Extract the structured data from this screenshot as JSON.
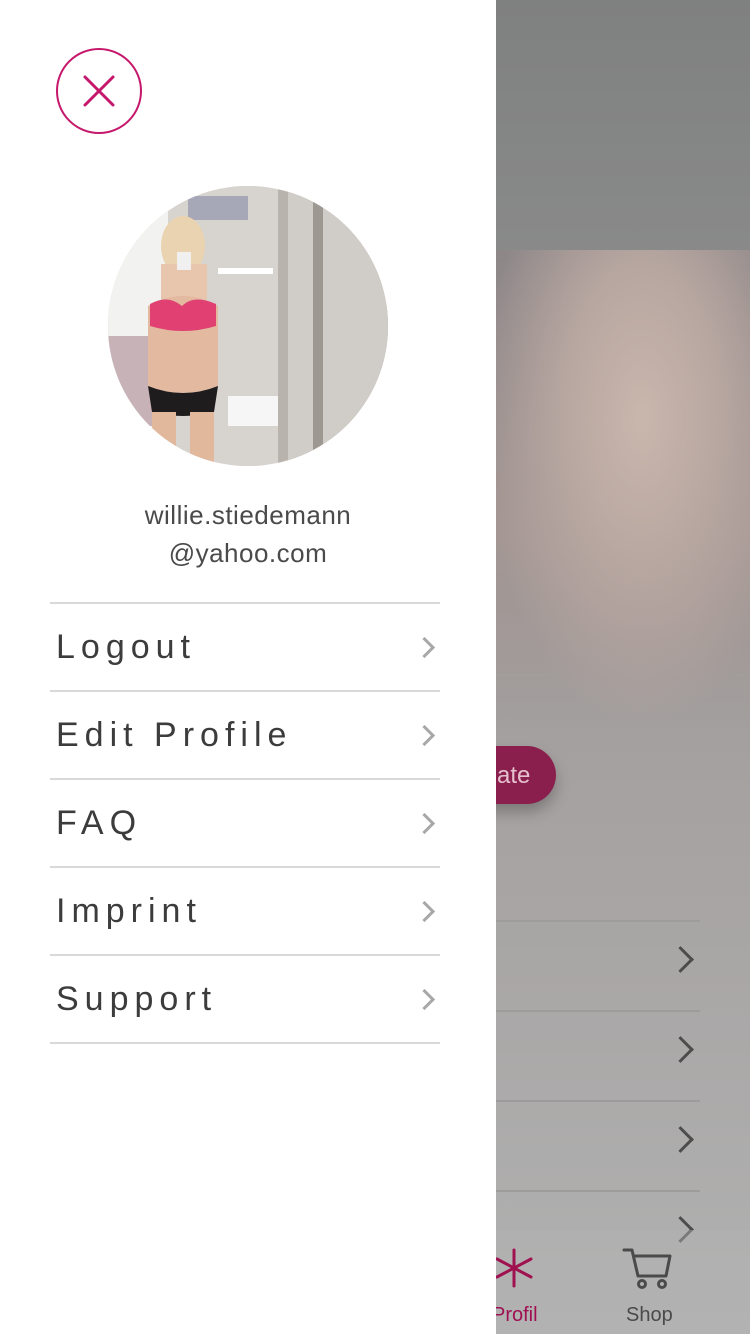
{
  "drawer": {
    "close_icon": "close-icon",
    "avatar_icon": "avatar-photo",
    "email_line1": "willie.stiedemann",
    "email_line2": "@yahoo.com",
    "menu": [
      {
        "label": "Logout"
      },
      {
        "label": "Edit Profile"
      },
      {
        "label": "FAQ"
      },
      {
        "label": "Imprint"
      },
      {
        "label": "Support"
      }
    ],
    "accent": "#c5186c",
    "chevron_color": "#a8a8a8"
  },
  "background": {
    "cta_label": "ate",
    "tabs": [
      {
        "label": "Profil",
        "icon": "asterisk-icon"
      },
      {
        "label": "Shop",
        "icon": "cart-icon"
      }
    ]
  }
}
